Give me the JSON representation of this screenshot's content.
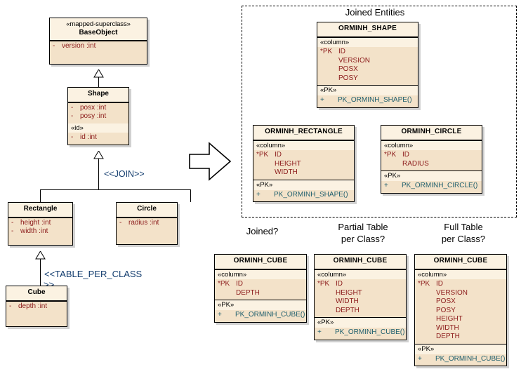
{
  "diagram": {
    "group_title": "Joined Entities",
    "edge_labels": {
      "join": "<<JOIN>>",
      "table_per_class_line1": "<<TABLE_PER_CLASS",
      "table_per_class_line2": ">>"
    },
    "variant_titles": {
      "joined": "Joined?",
      "partial_line1": "Partial Table",
      "partial_line2": "per Class?",
      "full_line1": "Full Table",
      "full_line2": "per Class?"
    },
    "colors": {
      "header_fill": "#fbf2e2",
      "body_fill": "#f3e2c9",
      "border": "#000000",
      "attribute_text": "#8b1a1a",
      "operation_text": "#1f5f6e",
      "label_text": "#123c6e"
    }
  },
  "classes": {
    "base_object": {
      "stereotype": "«mapped-superclass»",
      "name": "BaseObject",
      "attributes": [
        {
          "visibility": "-",
          "text": "version  :int"
        }
      ]
    },
    "shape": {
      "name": "Shape",
      "attributes": [
        {
          "visibility": "-",
          "text": "posx  :int"
        },
        {
          "visibility": "-",
          "text": "posy  :int"
        }
      ],
      "id_band": "«id»",
      "id_attributes": [
        {
          "visibility": "-",
          "text": "id  :int"
        }
      ]
    },
    "rectangle": {
      "name": "Rectangle",
      "attributes": [
        {
          "visibility": "-",
          "text": "height  :int"
        },
        {
          "visibility": "-",
          "text": "width  :int"
        }
      ]
    },
    "circle": {
      "name": "Circle",
      "attributes": [
        {
          "visibility": "-",
          "text": "radius  :int"
        }
      ]
    },
    "cube": {
      "name": "Cube",
      "attributes": [
        {
          "visibility": "-",
          "text": "depth  :int"
        }
      ]
    }
  },
  "tables": {
    "orminh_shape": {
      "name": "ORMINH_SHAPE",
      "column_band": "«column»",
      "columns": [
        {
          "key": "*PK",
          "name": "ID"
        },
        {
          "key": "",
          "name": "VERSION"
        },
        {
          "key": "",
          "name": "POSX"
        },
        {
          "key": "",
          "name": "POSY"
        }
      ],
      "pk_band": "«PK»",
      "operations": [
        {
          "visibility": "+",
          "name": "PK_ORMINH_SHAPE()"
        }
      ]
    },
    "orminh_rectangle": {
      "name": "ORMINH_RECTANGLE",
      "column_band": "«column»",
      "columns": [
        {
          "key": "*PK",
          "name": "ID"
        },
        {
          "key": "",
          "name": "HEIGHT"
        },
        {
          "key": "",
          "name": "WIDTH"
        }
      ],
      "pk_band": "«PK»",
      "operations": [
        {
          "visibility": "+",
          "name": "PK_ORMINH_SHAPE()"
        }
      ]
    },
    "orminh_circle": {
      "name": "ORMINH_CIRCLE",
      "column_band": "«column»",
      "columns": [
        {
          "key": "*PK",
          "name": "ID"
        },
        {
          "key": "",
          "name": "RADIUS"
        }
      ],
      "pk_band": "«PK»",
      "operations": [
        {
          "visibility": "+",
          "name": "PK_ORMINH_CIRCLE()"
        }
      ]
    },
    "orminh_cube_joined": {
      "name": "ORMINH_CUBE",
      "column_band": "«column»",
      "columns": [
        {
          "key": "*PK",
          "name": "ID"
        },
        {
          "key": "",
          "name": "DEPTH"
        }
      ],
      "pk_band": "«PK»",
      "operations": [
        {
          "visibility": "+",
          "name": "PK_ORMINH_CUBE()"
        }
      ]
    },
    "orminh_cube_partial": {
      "name": "ORMINH_CUBE",
      "column_band": "«column»",
      "columns": [
        {
          "key": "*PK",
          "name": "ID"
        },
        {
          "key": "",
          "name": "HEIGHT"
        },
        {
          "key": "",
          "name": "WIDTH"
        },
        {
          "key": "",
          "name": "DEPTH"
        }
      ],
      "pk_band": "«PK»",
      "operations": [
        {
          "visibility": "+",
          "name": "PK_ORMINH_CUBE()"
        }
      ]
    },
    "orminh_cube_full": {
      "name": "ORMINH_CUBE",
      "column_band": "«column»",
      "columns": [
        {
          "key": "*PK",
          "name": "ID"
        },
        {
          "key": "",
          "name": "VERSION"
        },
        {
          "key": "",
          "name": "POSX"
        },
        {
          "key": "",
          "name": "POSY"
        },
        {
          "key": "",
          "name": "HEIGHT"
        },
        {
          "key": "",
          "name": "WIDTH"
        },
        {
          "key": "",
          "name": "DEPTH"
        }
      ],
      "pk_band": "«PK»",
      "operations": [
        {
          "visibility": "+",
          "name": "PK_ORMINH_CUBE()"
        }
      ]
    }
  }
}
